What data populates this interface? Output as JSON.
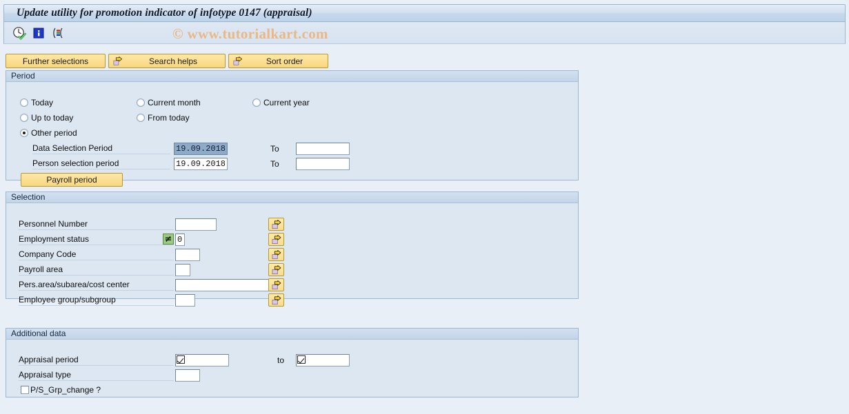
{
  "window": {
    "title": "Update utility for promotion indicator of infotype 0147 (appraisal)"
  },
  "toolbar": {
    "icons": [
      {
        "name": "execute-clock-check-icon",
        "title": "Execute"
      },
      {
        "name": "info-icon",
        "title": "Information"
      },
      {
        "name": "variant-icon",
        "title": "Get variant"
      }
    ],
    "watermark": "© www.tutorialkart.com"
  },
  "buttons": {
    "further_selections": "Further selections",
    "search_helps": "Search helps",
    "sort_order": "Sort order"
  },
  "period": {
    "title": "Period",
    "radios": [
      {
        "label": "Today",
        "checked": false
      },
      {
        "label": "Current month",
        "checked": false
      },
      {
        "label": "Current year",
        "checked": false
      },
      {
        "label": "Up to today",
        "checked": false
      },
      {
        "label": "From today",
        "checked": false
      },
      {
        "label": "Other period",
        "checked": true
      }
    ],
    "data_selection_period": {
      "label": "Data Selection Period",
      "from_value": "19.09.2018",
      "to_label": "To",
      "to_value": ""
    },
    "person_selection_period": {
      "label": "Person selection period",
      "from_value": "19.09.2018",
      "to_label": "To",
      "to_value": ""
    },
    "payroll_period_button": "Payroll period"
  },
  "selection": {
    "title": "Selection",
    "rows": [
      {
        "label": "Personnel Number",
        "value": "",
        "operator": null,
        "field_width": 60
      },
      {
        "label": "Employment status",
        "value": "0",
        "operator": "≠",
        "field_width": 14
      },
      {
        "label": "Company Code",
        "value": "",
        "field_width": 36
      },
      {
        "label": "Payroll area",
        "value": "",
        "field_width": 22
      },
      {
        "label": "Pers.area/subarea/cost center",
        "value": "",
        "field_width": 145
      },
      {
        "label": "Employee group/subgroup",
        "value": "",
        "field_width": 29
      }
    ],
    "multi_select_icon": "multi-selection-arrow-icon"
  },
  "additional": {
    "title": "Additional data",
    "appraisal_period": {
      "label": "Appraisal period",
      "from_value": "",
      "to_label": "to",
      "to_value": ""
    },
    "appraisal_type": {
      "label": "Appraisal type",
      "value": ""
    },
    "ps_grp_change": {
      "label": "P/S_Grp_change ?",
      "checked": false
    }
  },
  "colors": {
    "page_background": "#e9eff7",
    "panel_background": "#dde7f2",
    "panel_border": "#9eb6d0",
    "title_bar": "#c7d8ec",
    "button_yellow": "#fbdf93",
    "button_border": "#b8982f",
    "selected_field": "#8fa9c8",
    "operator_green": "#9ccb7f",
    "watermark": "#e8b887"
  }
}
